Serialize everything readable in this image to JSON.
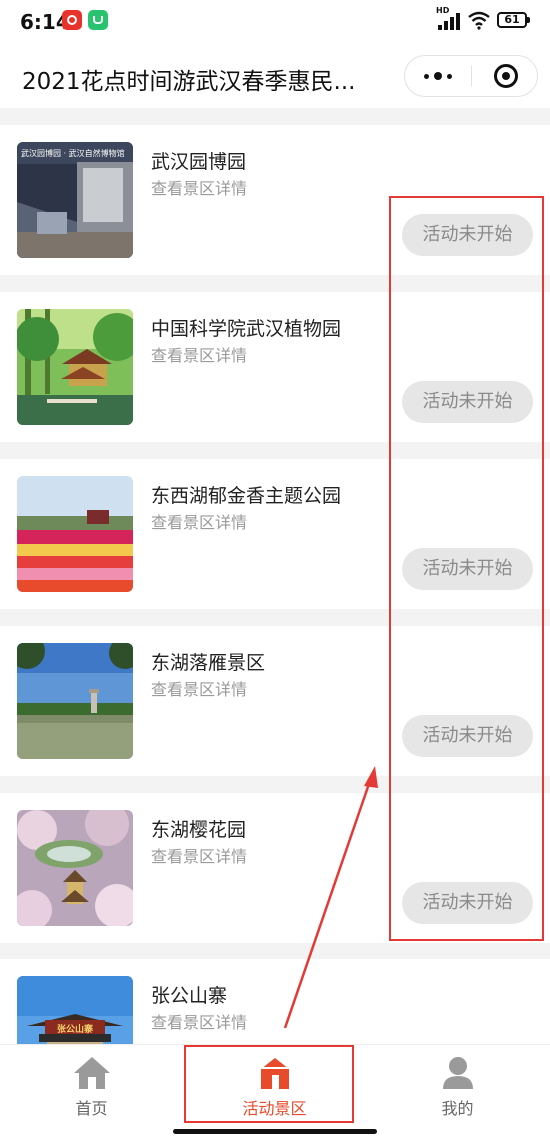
{
  "status_bar": {
    "time": "6:14",
    "battery": "61",
    "network": "HD"
  },
  "nav": {
    "title": "2021花点时间游武汉春季惠民..."
  },
  "list": {
    "items": [
      {
        "name": "武汉园博园",
        "link_text": "查看景区详情",
        "status": "活动未开始",
        "thumb_caption": "武汉园博园 · 武汉自然博物馆"
      },
      {
        "name": "中国科学院武汉植物园",
        "link_text": "查看景区详情",
        "status": "活动未开始"
      },
      {
        "name": "东西湖郁金香主题公园",
        "link_text": "查看景区详情",
        "status": "活动未开始"
      },
      {
        "name": "东湖落雁景区",
        "link_text": "查看景区详情",
        "status": "活动未开始"
      },
      {
        "name": "东湖樱花园",
        "link_text": "查看景区详情",
        "status": "活动未开始"
      },
      {
        "name": "张公山寨",
        "link_text": "查看景区详情",
        "thumb_caption": "张公山寨"
      }
    ]
  },
  "tab_bar": {
    "tabs": [
      {
        "label": "首页",
        "icon": "home-icon"
      },
      {
        "label": "活动景区",
        "icon": "scenic-area-icon",
        "active": true
      },
      {
        "label": "我的",
        "icon": "profile-icon"
      }
    ]
  },
  "colors": {
    "accent": "#e84a2c",
    "annotation": "#e53935",
    "status_bg": "#e6e6e6"
  }
}
